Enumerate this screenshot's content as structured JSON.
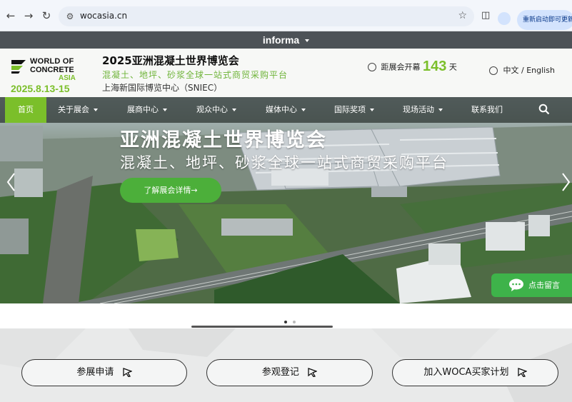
{
  "browser": {
    "url": "wocasia.cn",
    "update_button": "重新启动即可更新"
  },
  "informa_bar": {
    "label": "informa"
  },
  "header": {
    "logo": {
      "line1": "WORLD OF",
      "line2": "CONCRETE",
      "line3": "ASIA",
      "date": "2025.8.13-15"
    },
    "title": "2025亚洲混凝土世界博览会",
    "slogan": "混凝土、地坪、砂浆全球一站式商贸采购平台",
    "venue": "上海新国际博览中心（SNIEC）",
    "countdown": {
      "prefix": "距展会开幕",
      "days": "143",
      "suffix": "天"
    },
    "language": "中文 / English"
  },
  "nav": {
    "items": [
      {
        "label": "首页",
        "dropdown": false
      },
      {
        "label": "关于展会",
        "dropdown": true
      },
      {
        "label": "展商中心",
        "dropdown": true
      },
      {
        "label": "观众中心",
        "dropdown": true
      },
      {
        "label": "媒体中心",
        "dropdown": true
      },
      {
        "label": "国际奖项",
        "dropdown": true
      },
      {
        "label": "现场活动",
        "dropdown": true
      },
      {
        "label": "联系我们",
        "dropdown": false
      }
    ]
  },
  "hero": {
    "title": "亚洲混凝土世界博览会",
    "subtitle": "混凝土、地坪、砂浆全球一站式商贸采购平台",
    "button": "了解展会详情→",
    "message_button": "点击留言"
  },
  "carousel": {
    "slides": 2,
    "active": 1
  },
  "ctas": [
    {
      "label": "参展申请"
    },
    {
      "label": "参观登记"
    },
    {
      "label": "加入WOCA买家计划"
    }
  ],
  "colors": {
    "brand_green": "#7bbf2a",
    "informa_bar": "#4d5257",
    "cta_green": "#4caf3a"
  }
}
